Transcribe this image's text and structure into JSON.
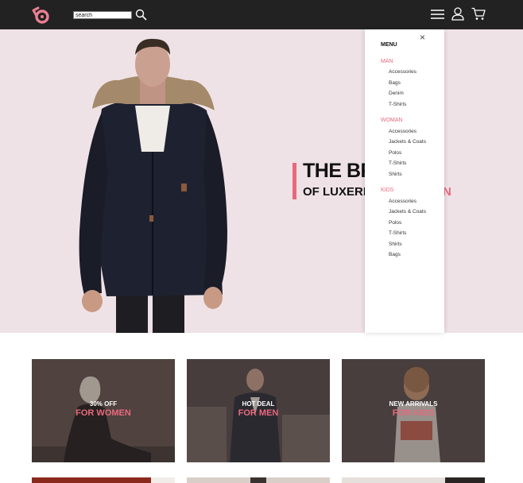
{
  "header": {
    "logo_icon": "brand-logo-icon",
    "search_value": "search",
    "search_icon": "search-icon",
    "menu_icon": "hamburger-icon",
    "user_icon": "user-icon",
    "cart_icon": "cart-icon"
  },
  "hero": {
    "title": "THE BR",
    "subtitle_dark": "OF LUXERI",
    "subtitle_pink": "N",
    "accent_color": "#e8697d"
  },
  "menu": {
    "title": "MENU",
    "close": "×",
    "categories": [
      {
        "label": "MAN",
        "items": [
          "Accessories",
          "Bags",
          "Denim",
          "T-Shirts"
        ]
      },
      {
        "label": "WOMAN",
        "items": [
          "Accessories",
          "Jackets & Coats",
          "Polos",
          "T-Shirts",
          "Shirts"
        ]
      },
      {
        "label": "KIDS",
        "items": [
          "Accessories",
          "Jackets & Coats",
          "Polos",
          "T-Shirts",
          "Shirts",
          "Bags"
        ]
      }
    ]
  },
  "cards": [
    {
      "small": "30% OFF",
      "big": "FOR WOMEN"
    },
    {
      "small": "HOT DEAL",
      "big": "FOR MEN"
    },
    {
      "small": "NEW ARRIVALS",
      "big": "FOR KIDS"
    }
  ],
  "colors": {
    "topbar": "#222222",
    "hero_bg": "#efe2e6",
    "accent": "#e8697d"
  }
}
